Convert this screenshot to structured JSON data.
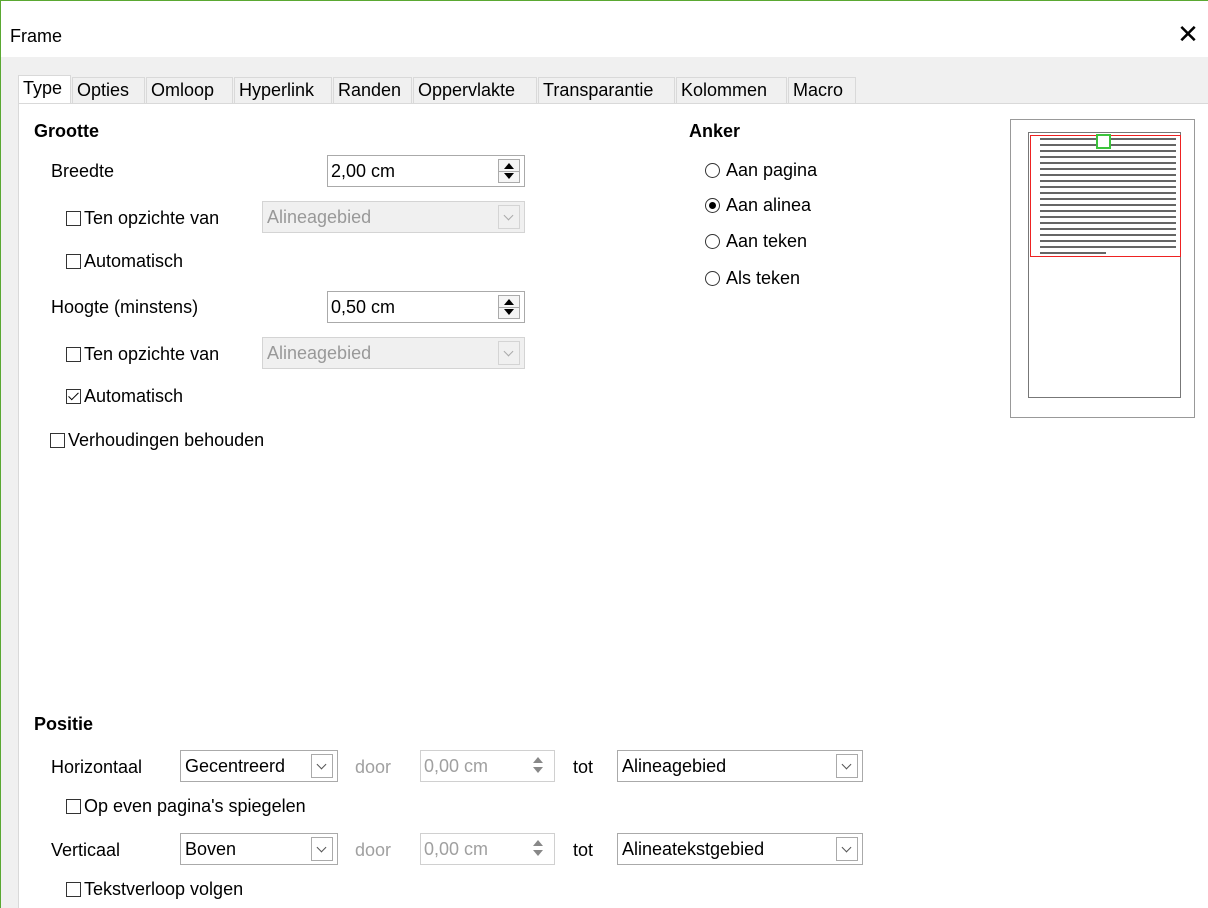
{
  "window": {
    "title": "Frame",
    "close_glyph": "✕"
  },
  "tabs": [
    {
      "label": "Type",
      "active": true
    },
    {
      "label": "Opties"
    },
    {
      "label": "Omloop"
    },
    {
      "label": "Hyperlink"
    },
    {
      "label": "Randen"
    },
    {
      "label": "Oppervlakte"
    },
    {
      "label": "Transparantie"
    },
    {
      "label": "Kolommen"
    },
    {
      "label": "Macro"
    }
  ],
  "grootte": {
    "heading": "Grootte",
    "breedte": {
      "label": "Breedte",
      "value": "2,00 cm"
    },
    "breedte_relative": {
      "label": "Ten opzichte van",
      "checked": false,
      "select_value": "Alineagebied"
    },
    "breedte_auto": {
      "label": "Automatisch",
      "checked": false
    },
    "hoogte": {
      "label": "Hoogte (minstens)",
      "value": "0,50 cm"
    },
    "hoogte_relative": {
      "label": "Ten opzichte van",
      "checked": false,
      "select_value": "Alineagebied"
    },
    "hoogte_auto": {
      "label": "Automatisch",
      "checked": true
    },
    "keep_ratio": {
      "label": "Verhoudingen behouden",
      "checked": false
    }
  },
  "anker": {
    "heading": "Anker",
    "options": [
      {
        "label": "Aan pagina",
        "checked": false
      },
      {
        "label": "Aan alinea",
        "checked": true
      },
      {
        "label": "Aan teken",
        "checked": false
      },
      {
        "label": "Als teken",
        "checked": false
      }
    ]
  },
  "positie": {
    "heading": "Positie",
    "horizontaal": {
      "label": "Horizontaal",
      "select": "Gecentreerd",
      "door_label": "door",
      "door_value": "0,00 cm",
      "tot_label": "tot",
      "tot_select": "Alineagebied"
    },
    "mirror": {
      "label": "Op even pagina's spiegelen",
      "checked": false
    },
    "verticaal": {
      "label": "Verticaal",
      "select": "Boven",
      "door_label": "door",
      "door_value": "0,00 cm",
      "tot_label": "tot",
      "tot_select": "Alineatekstgebied"
    },
    "follow": {
      "label": "Tekstverloop volgen",
      "checked": false
    }
  },
  "colors": {
    "frame_border": "#5aa832",
    "preview_frame": "#e22222",
    "preview_anchor": "#3cc33c"
  }
}
